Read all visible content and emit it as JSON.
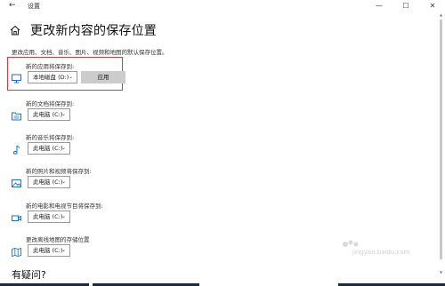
{
  "window": {
    "title": "设置",
    "back_icon": "arrow-left-icon",
    "min_icon": "minimize-icon",
    "max_icon": "maximize-icon",
    "close_icon": "close-icon"
  },
  "header": {
    "title": "更改新内容的保存位置",
    "icon": "home-icon"
  },
  "description": "更改应用、文档、音乐、图片、视频和地图的默认保存位置。",
  "settings": [
    {
      "label": "新的应用将保存到:",
      "value": "本地磁盘 (D:)",
      "icon": "monitor-icon",
      "button": "应用"
    },
    {
      "label": "新的文档将保存到:",
      "value": "此电脑 (C:)",
      "icon": "folder-icon"
    },
    {
      "label": "新的音乐将保存到:",
      "value": "此电脑 (C:)",
      "icon": "music-note-icon"
    },
    {
      "label": "新的照片和视频将保存到:",
      "value": "此电脑 (C:)",
      "icon": "picture-icon"
    },
    {
      "label": "新的电影和电视节目将保存到:",
      "value": "此电脑 (C:)",
      "icon": "video-camera-icon"
    },
    {
      "label": "更改离线地图的存储位置",
      "value": "此电脑 (C:)",
      "icon": "map-icon"
    }
  ],
  "faq": "有疑问?",
  "watermark": "jingyan.baidu.com",
  "colors": {
    "highlight": "#e0393e",
    "icon_blue": "#1a73c9",
    "button_gray": "#cccccc"
  }
}
